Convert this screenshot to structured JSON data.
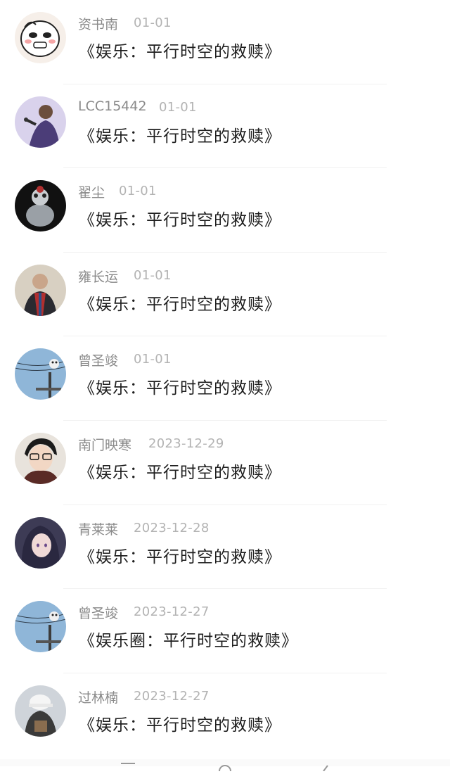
{
  "feed": {
    "items": [
      {
        "name": "资书南",
        "date": "01-01",
        "title": "《娱乐：平行时空的救赎》",
        "avatar": "cartoon-face"
      },
      {
        "name": "LCC15442",
        "date": "01-01",
        "title": "《娱乐：平行时空的救赎》",
        "avatar": "singer-purple"
      },
      {
        "name": "翟尘",
        "date": "01-01",
        "title": "《娱乐：平行时空的救赎》",
        "avatar": "dark-figurine"
      },
      {
        "name": "雍长运",
        "date": "01-01",
        "title": "《娱乐：平行时空的救赎》",
        "avatar": "man-scarf"
      },
      {
        "name": "曾圣竣",
        "date": "01-01",
        "title": "《娱乐：平行时空的救赎》",
        "avatar": "sky-wires"
      },
      {
        "name": "南门映寒",
        "date": "2023-12-29",
        "title": "《娱乐：平行时空的救赎》",
        "avatar": "anime-glasses"
      },
      {
        "name": "青莱莱",
        "date": "2023-12-28",
        "title": "《娱乐：平行时空的救赎》",
        "avatar": "anime-girl"
      },
      {
        "name": "曾圣竣",
        "date": "2023-12-27",
        "title": "《娱乐圈：平行时空的救赎》",
        "avatar": "sky-wires"
      },
      {
        "name": "过林楠",
        "date": "2023-12-27",
        "title": "《娱乐：平行时空的救赎》",
        "avatar": "person-cap"
      }
    ]
  }
}
